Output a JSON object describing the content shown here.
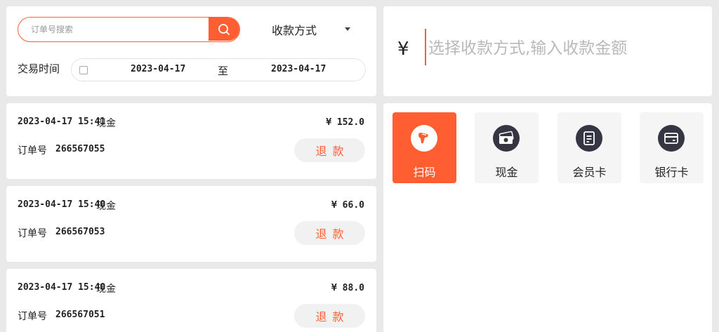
{
  "search": {
    "placeholder": "订单号搜索"
  },
  "pay_filter": {
    "selected": "收款方式"
  },
  "date_filter": {
    "label": "交易时间",
    "start": "2023-04-17",
    "separator": "至",
    "end": "2023-04-17"
  },
  "amount": {
    "currency": "¥",
    "placeholder": "选择收款方式,输入收款金额"
  },
  "orders": [
    {
      "time": "2023-04-17 15:41",
      "method": "现金",
      "amount": "¥ 152.0",
      "order_no_label": "订单号",
      "order_no": "266567055",
      "refund_label": "退款"
    },
    {
      "time": "2023-04-17 15:40",
      "method": "现金",
      "amount": "¥ 66.0",
      "order_no_label": "订单号",
      "order_no": "266567053",
      "refund_label": "退款"
    },
    {
      "time": "2023-04-17 15:40",
      "method": "现金",
      "amount": "¥ 88.0",
      "order_no_label": "订单号",
      "order_no": "266567051",
      "refund_label": "退款"
    }
  ],
  "pay_methods": [
    {
      "label": "扫码",
      "icon": "scanner-icon",
      "active": true
    },
    {
      "label": "现金",
      "icon": "cash-icon",
      "active": false
    },
    {
      "label": "会员卡",
      "icon": "member-card-icon",
      "active": false
    },
    {
      "label": "银行卡",
      "icon": "bank-card-icon",
      "active": false
    }
  ],
  "colors": {
    "accent": "#ff5e32",
    "icon_bg": "#353543",
    "background": "#e9e9ea"
  }
}
